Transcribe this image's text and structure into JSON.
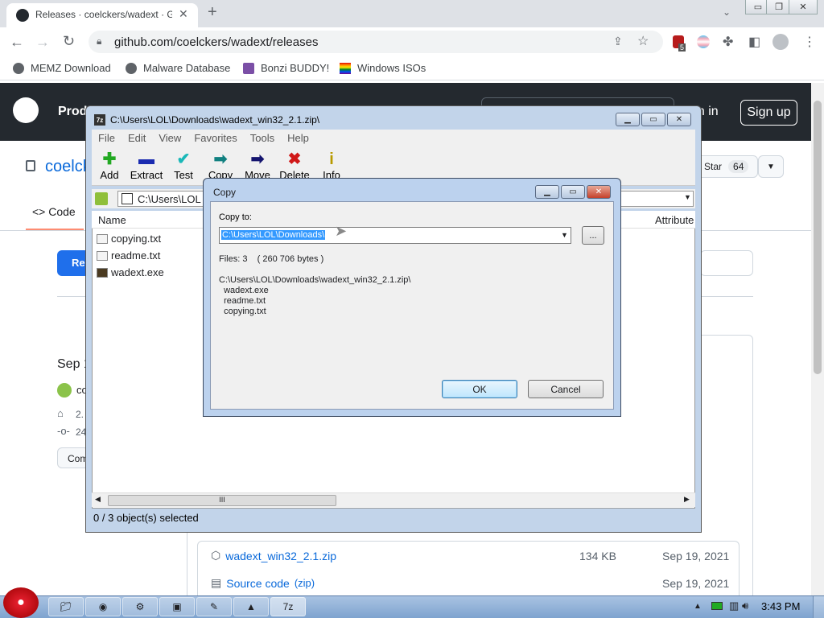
{
  "browser": {
    "tab_title": "Releases · coelckers/wadext · G",
    "url": "github.com/coelckers/wadext/releases",
    "bookmarks": [
      "MEMZ Download",
      "Malware Database",
      "Bonzi BUDDY!",
      "Windows ISOs"
    ],
    "ext_badge": "5"
  },
  "github": {
    "prod": "Prod",
    "sign_in": "gn in",
    "sign_up": "Sign up",
    "repo": "coelck",
    "star_label": "Star",
    "star_count": "64",
    "code_tab": "Code",
    "release_btn": "Re",
    "release_date": "Sep 1",
    "release_author": "co",
    "tag": "2.",
    "commit": "24",
    "compare": "Com",
    "assets": [
      {
        "name": "wadext_win32_2.1.zip",
        "ext": "",
        "size": "134 KB",
        "date": "Sep 19, 2021"
      },
      {
        "name": "Source code",
        "ext": "(zip)",
        "size": "",
        "date": "Sep 19, 2021"
      }
    ]
  },
  "sevenzip": {
    "title": "C:\\Users\\LOL\\Downloads\\wadext_win32_2.1.zip\\",
    "menu": [
      "File",
      "Edit",
      "View",
      "Favorites",
      "Tools",
      "Help"
    ],
    "toolbar": [
      {
        "label": "Add",
        "icon": "plus-icon",
        "glyph": "✚",
        "color": "#22a822"
      },
      {
        "label": "Extract",
        "icon": "minus-icon",
        "glyph": "▬",
        "color": "#1a2bb0"
      },
      {
        "label": "Test",
        "icon": "check-icon",
        "glyph": "✔",
        "color": "#1ab8b8"
      },
      {
        "label": "Copy",
        "icon": "copy-arrow-icon",
        "glyph": "➡",
        "color": "#118080"
      },
      {
        "label": "Move",
        "icon": "move-arrow-icon",
        "glyph": "➡",
        "color": "#14146e"
      },
      {
        "label": "Delete",
        "icon": "delete-icon",
        "glyph": "✖",
        "color": "#d01818"
      },
      {
        "label": "Info",
        "icon": "info-icon",
        "glyph": "i",
        "color": "#b89a00"
      }
    ],
    "address": "C:\\Users\\LOL",
    "columns": {
      "name": "Name",
      "attributes": "Attribute"
    },
    "files": [
      "copying.txt",
      "readme.txt",
      "wadext.exe"
    ],
    "status": "0 / 3 object(s) selected"
  },
  "copy_dialog": {
    "title": "Copy",
    "copy_to_label": "Copy to:",
    "path": "C:\\Users\\LOL\\Downloads\\",
    "browse": "...",
    "files_info": "Files: 3    ( 260 706 bytes )",
    "list": "C:\\Users\\LOL\\Downloads\\wadext_win32_2.1.zip\\\n  wadext.exe\n  readme.txt\n  copying.txt",
    "ok": "OK",
    "cancel": "Cancel"
  },
  "taskbar": {
    "clock": "3:43 PM"
  }
}
